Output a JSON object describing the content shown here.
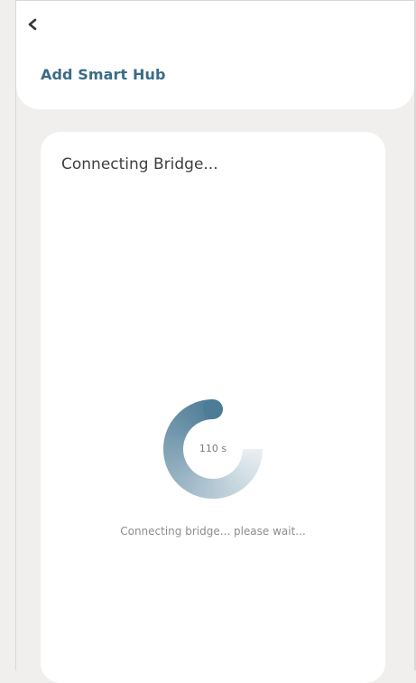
{
  "header": {
    "back_icon": "chevron-left-icon",
    "title": "Add Smart Hub"
  },
  "card": {
    "title": "Connecting Bridge...",
    "timer": {
      "label": "110 s",
      "progress_fraction": 0.75
    },
    "status": "Connecting bridge... please wait..."
  },
  "colors": {
    "accent": "#3b6c86",
    "spinner_start": "#e8eef2",
    "spinner_end": "#4d7c97",
    "background": "#f0efed"
  }
}
